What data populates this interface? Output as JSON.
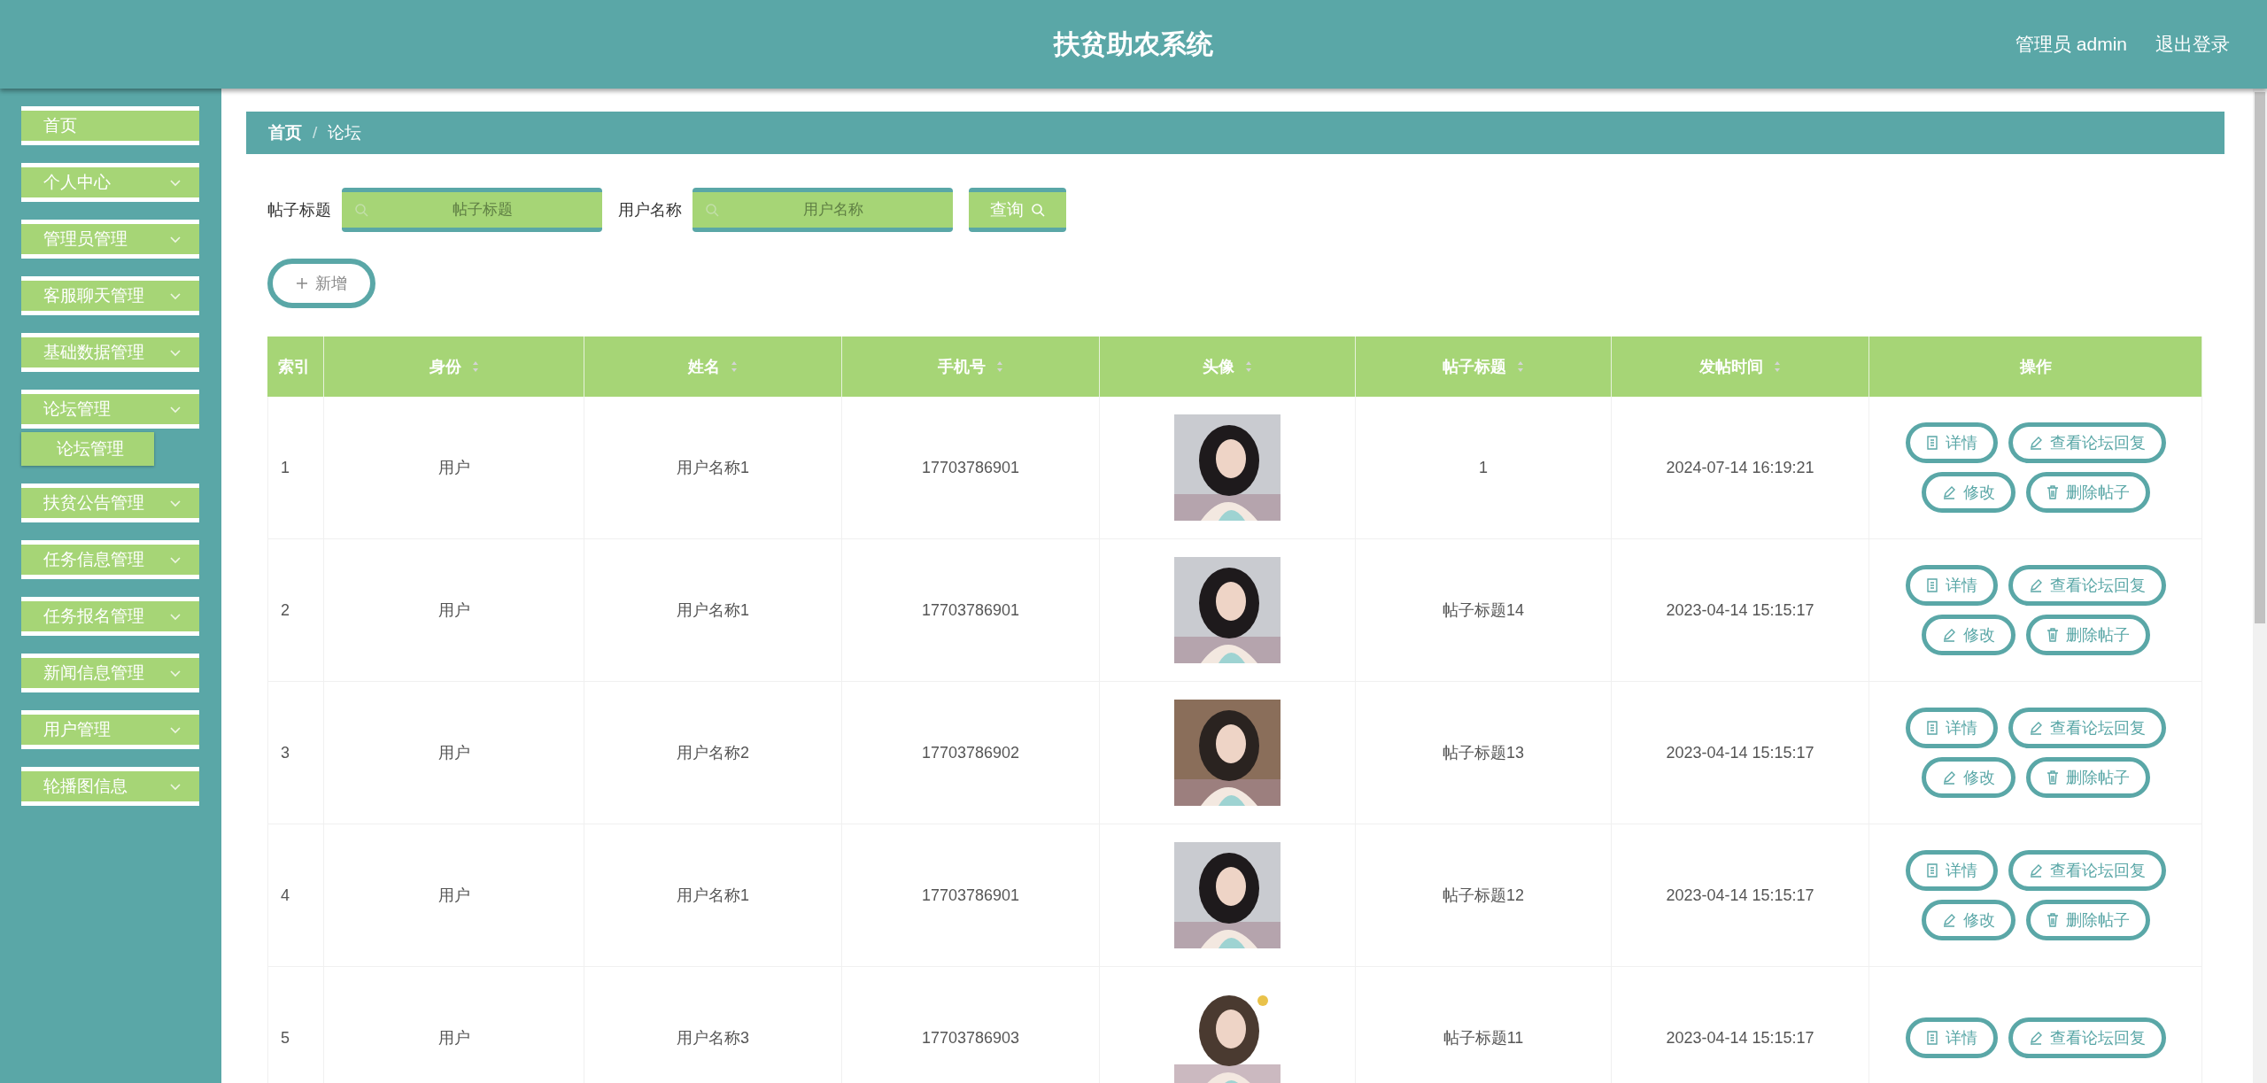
{
  "header": {
    "title": "扶贫助农系统",
    "user": "管理员 admin",
    "logout": "退出登录"
  },
  "sidebar": {
    "items": [
      {
        "label": "首页",
        "kind": "link"
      },
      {
        "label": "个人中心",
        "kind": "menu"
      },
      {
        "label": "管理员管理",
        "kind": "menu"
      },
      {
        "label": "客服聊天管理",
        "kind": "menu"
      },
      {
        "label": "基础数据管理",
        "kind": "menu"
      },
      {
        "label": "论坛管理",
        "kind": "menu",
        "children": [
          {
            "label": "论坛管理"
          }
        ]
      },
      {
        "label": "扶贫公告管理",
        "kind": "menu"
      },
      {
        "label": "任务信息管理",
        "kind": "menu"
      },
      {
        "label": "任务报名管理",
        "kind": "menu"
      },
      {
        "label": "新闻信息管理",
        "kind": "menu"
      },
      {
        "label": "用户管理",
        "kind": "menu"
      },
      {
        "label": "轮播图信息",
        "kind": "menu"
      }
    ]
  },
  "breadcrumb": {
    "items": [
      "首页",
      "论坛"
    ],
    "separator": "/"
  },
  "search": {
    "fields": [
      {
        "label": "帖子标题",
        "placeholder": "帖子标题"
      },
      {
        "label": "用户名称",
        "placeholder": "用户名称"
      }
    ],
    "button": "查询"
  },
  "add_button": "新增",
  "table": {
    "columns": [
      {
        "label": "索引",
        "sortable": false
      },
      {
        "label": "身份",
        "sortable": true
      },
      {
        "label": "姓名",
        "sortable": true
      },
      {
        "label": "手机号",
        "sortable": true
      },
      {
        "label": "头像",
        "sortable": true
      },
      {
        "label": "帖子标题",
        "sortable": true
      },
      {
        "label": "发帖时间",
        "sortable": true
      },
      {
        "label": "操作",
        "sortable": false
      }
    ],
    "rows": [
      {
        "index": "1",
        "role": "用户",
        "name": "用户名称1",
        "phone": "17703786901",
        "title": "1",
        "time": "2024-07-14 16:19:21",
        "actions": [
          {
            "label": "详情",
            "kind": "detail"
          },
          {
            "label": "查看论坛回复",
            "kind": "edit"
          },
          {
            "label": "修改",
            "kind": "edit"
          },
          {
            "label": "删除帖子",
            "kind": "delete"
          }
        ]
      },
      {
        "index": "2",
        "role": "用户",
        "name": "用户名称1",
        "phone": "17703786901",
        "title": "帖子标题14",
        "time": "2023-04-14 15:15:17",
        "actions": [
          {
            "label": "详情",
            "kind": "detail"
          },
          {
            "label": "查看论坛回复",
            "kind": "edit"
          },
          {
            "label": "修改",
            "kind": "edit"
          },
          {
            "label": "删除帖子",
            "kind": "delete"
          }
        ]
      },
      {
        "index": "3",
        "role": "用户",
        "name": "用户名称2",
        "phone": "17703786902",
        "title": "帖子标题13",
        "time": "2023-04-14 15:15:17",
        "actions": [
          {
            "label": "详情",
            "kind": "detail"
          },
          {
            "label": "查看论坛回复",
            "kind": "edit"
          },
          {
            "label": "修改",
            "kind": "edit"
          },
          {
            "label": "删除帖子",
            "kind": "delete"
          }
        ]
      },
      {
        "index": "4",
        "role": "用户",
        "name": "用户名称1",
        "phone": "17703786901",
        "title": "帖子标题12",
        "time": "2023-04-14 15:15:17",
        "actions": [
          {
            "label": "详情",
            "kind": "detail"
          },
          {
            "label": "查看论坛回复",
            "kind": "edit"
          },
          {
            "label": "修改",
            "kind": "edit"
          },
          {
            "label": "删除帖子",
            "kind": "delete"
          }
        ]
      },
      {
        "index": "5",
        "role": "用户",
        "name": "用户名称3",
        "phone": "17703786903",
        "title": "帖子标题11",
        "time": "2023-04-14 15:15:17",
        "actions": [
          {
            "label": "详情",
            "kind": "detail"
          },
          {
            "label": "查看论坛回复",
            "kind": "edit"
          }
        ]
      }
    ]
  }
}
